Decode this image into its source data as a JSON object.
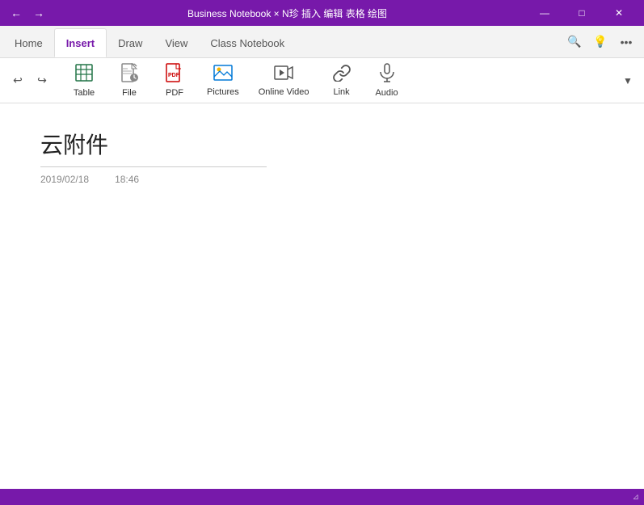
{
  "titlebar": {
    "title": "Business Notebook × N珍 插入 编辑 表格 绘图",
    "back_arrow": "←",
    "forward_arrow": "→",
    "minimize": "—",
    "maximize": "□",
    "close": "✕"
  },
  "menubar_cn": {
    "items": [
      "珍",
      "插入",
      "编辑",
      "表格",
      "绘图"
    ]
  },
  "tabs": {
    "items": [
      "Home",
      "Insert",
      "Draw",
      "View",
      "Class Notebook"
    ],
    "active": "Insert"
  },
  "tabbar_right": {
    "search_icon": "🔍",
    "lightbulb_icon": "💡",
    "more_icon": "···"
  },
  "ribbon": {
    "undo_label": "↩",
    "redo_label": "↪",
    "items": [
      {
        "id": "table",
        "icon": "⊞",
        "label": "Table"
      },
      {
        "id": "file",
        "icon": "📎",
        "label": "File"
      },
      {
        "id": "pdf",
        "icon": "📄",
        "label": "PDF"
      },
      {
        "id": "pictures",
        "icon": "🖼",
        "label": "Pictures"
      },
      {
        "id": "online-video",
        "icon": "▶",
        "label": "Online Video"
      },
      {
        "id": "link",
        "icon": "🔗",
        "label": "Link"
      },
      {
        "id": "audio",
        "icon": "🎙",
        "label": "Audio"
      }
    ],
    "more_icon": "▼"
  },
  "content": {
    "page_title": "云附件",
    "date": "2019/02/18",
    "time": "18:46"
  },
  "statusbar": {
    "resize_char": "⊿"
  }
}
